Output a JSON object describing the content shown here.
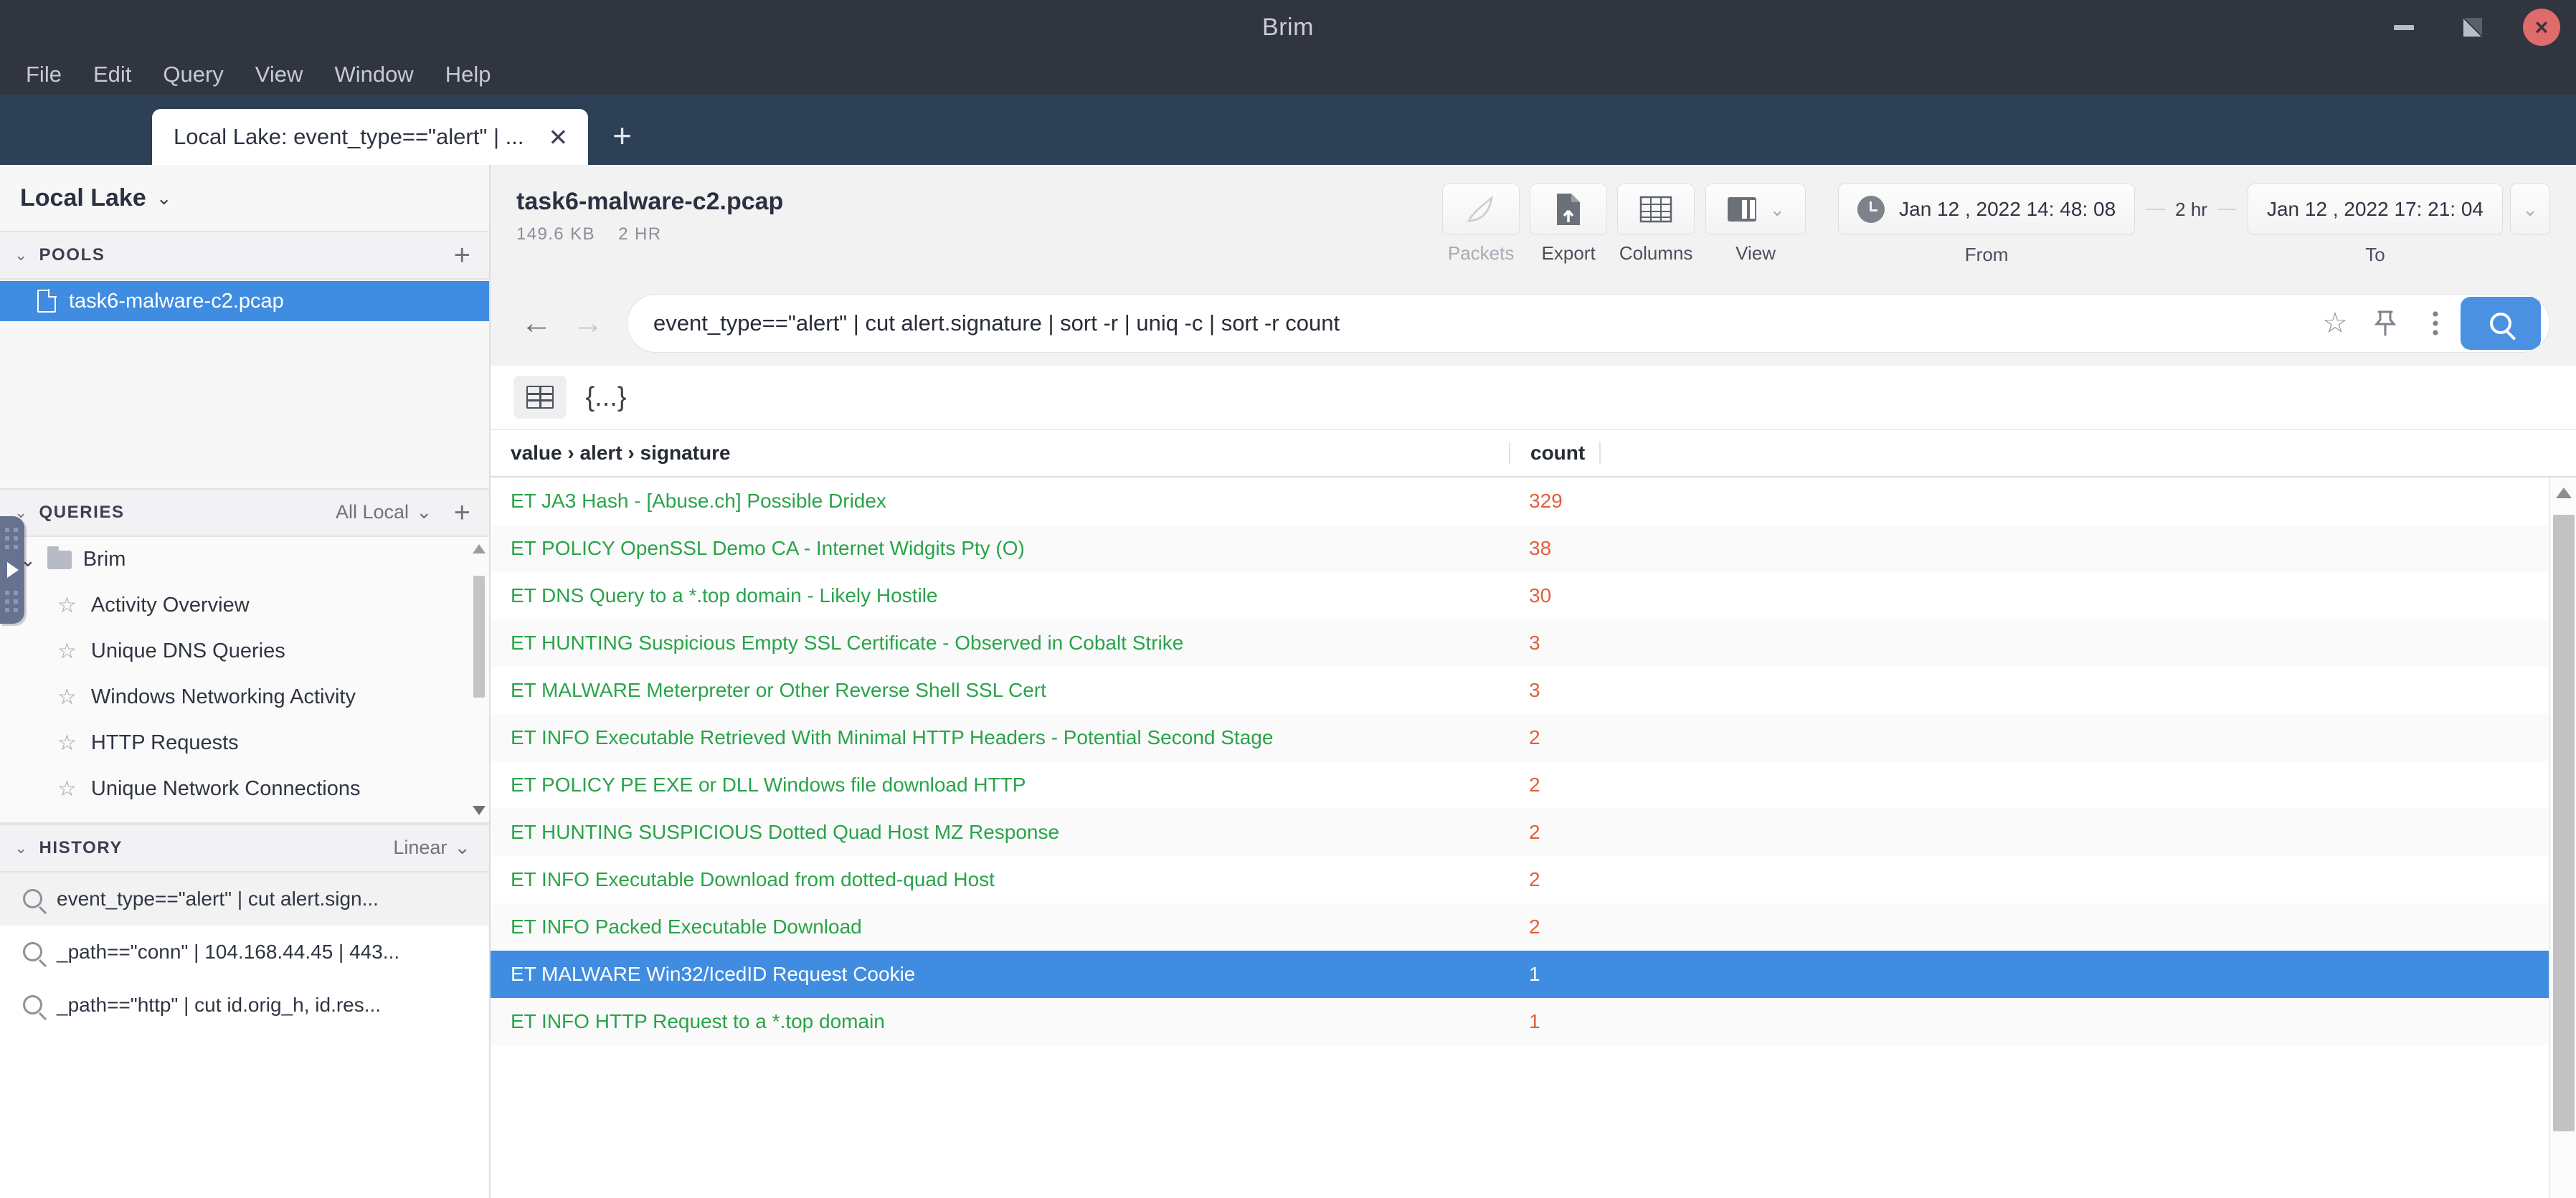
{
  "window": {
    "title": "Brim",
    "controls": {
      "minimize": "minimize-icon",
      "maximize": "maximize-icon",
      "close": "×"
    }
  },
  "menubar": {
    "items": [
      "File",
      "Edit",
      "Query",
      "View",
      "Window",
      "Help"
    ]
  },
  "tabbar": {
    "tabs": [
      {
        "label": "Local Lake: event_type==\"alert\" | ...",
        "close": "✕",
        "active": true
      }
    ],
    "add_label": "+"
  },
  "sidebar": {
    "lake_name": "Local Lake",
    "lake_caret": "⌄",
    "pools": {
      "title": "POOLS",
      "caret": "⌄",
      "add": "+",
      "items": [
        {
          "label": "task6-malware-c2.pcap",
          "selected": true
        }
      ]
    },
    "queries": {
      "title": "QUERIES",
      "caret": "⌄",
      "scope": "All Local",
      "scope_caret": "⌄",
      "add": "+",
      "folder": "Brim",
      "folder_caret": "⌄",
      "items": [
        {
          "label": "Activity Overview"
        },
        {
          "label": "Unique DNS Queries"
        },
        {
          "label": "Windows Networking Activity"
        },
        {
          "label": "HTTP Requests"
        },
        {
          "label": "Unique Network Connections"
        }
      ]
    },
    "history": {
      "title": "HISTORY",
      "caret": "⌄",
      "mode": "Linear",
      "mode_caret": "⌄",
      "items": [
        {
          "label": "event_type==\"alert\" | cut alert.sign...",
          "active": true
        },
        {
          "label": "_path==\"conn\" | 104.168.44.45 | 443...",
          "active": false
        },
        {
          "label": "_path==\"http\" | cut id.orig_h, id.res...",
          "active": false
        }
      ]
    }
  },
  "toolbar": {
    "file_title": "task6-malware-c2.pcap",
    "file_size": "149.6 KB",
    "file_duration": "2 HR",
    "buttons": [
      {
        "label": "Packets",
        "icon": "shark-fin-icon",
        "disabled": true
      },
      {
        "label": "Export",
        "icon": "file-export-icon",
        "disabled": false
      },
      {
        "label": "Columns",
        "icon": "table-columns-icon",
        "disabled": false
      }
    ],
    "view": {
      "label": "View",
      "icon": "layout-icon",
      "caret": "⌄"
    },
    "time": {
      "from_label": "From",
      "from_value": "Jan 12 , 2022  14: 48: 08",
      "duration": "2 hr",
      "to_label": "To",
      "to_value": "Jan 12 , 2022  17: 21: 04",
      "caret": "⌄",
      "clock_icon": "clock-icon"
    }
  },
  "searchbar": {
    "back": "←",
    "forward": "→",
    "query": "event_type==\"alert\" | cut alert.signature | sort -r | uniq -c | sort -r count",
    "star": "☆",
    "pin": "⚲",
    "kebab": "⋮",
    "search_icon": "search-icon"
  },
  "results": {
    "view_modes": [
      {
        "name": "table-view",
        "icon": "table-icon",
        "active": true
      },
      {
        "name": "json-view",
        "icon": "{...}",
        "active": false
      }
    ],
    "columns": [
      "value › alert › signature",
      "count"
    ],
    "rows": [
      {
        "signature": "ET JA3 Hash - [Abuse.ch] Possible Dridex",
        "count": "329",
        "selected": false
      },
      {
        "signature": "ET POLICY OpenSSL Demo CA - Internet Widgits Pty (O)",
        "count": "38",
        "selected": false
      },
      {
        "signature": "ET DNS Query to a *.top domain - Likely Hostile",
        "count": "30",
        "selected": false
      },
      {
        "signature": "ET HUNTING Suspicious Empty SSL Certificate - Observed in Cobalt Strike",
        "count": "3",
        "selected": false
      },
      {
        "signature": "ET MALWARE Meterpreter or Other Reverse Shell SSL Cert",
        "count": "3",
        "selected": false
      },
      {
        "signature": "ET INFO Executable Retrieved With Minimal HTTP Headers - Potential Second Stage",
        "count": "2",
        "selected": false
      },
      {
        "signature": "ET POLICY PE EXE or DLL Windows file download HTTP",
        "count": "2",
        "selected": false
      },
      {
        "signature": "ET HUNTING SUSPICIOUS Dotted Quad Host MZ Response",
        "count": "2",
        "selected": false
      },
      {
        "signature": "ET INFO Executable Download from dotted-quad Host",
        "count": "2",
        "selected": false
      },
      {
        "signature": "ET INFO Packed Executable Download",
        "count": "2",
        "selected": false
      },
      {
        "signature": "ET MALWARE Win32/IcedID Request Cookie",
        "count": "1",
        "selected": true
      },
      {
        "signature": "ET INFO HTTP Request to a *.top domain",
        "count": "1",
        "selected": false
      }
    ]
  },
  "colors": {
    "accent_blue": "#3f8ce0",
    "signature_green": "#2aa34a",
    "count_orange": "#e25f3a",
    "titlebar": "#31353f",
    "tabbar": "#2d4056"
  }
}
